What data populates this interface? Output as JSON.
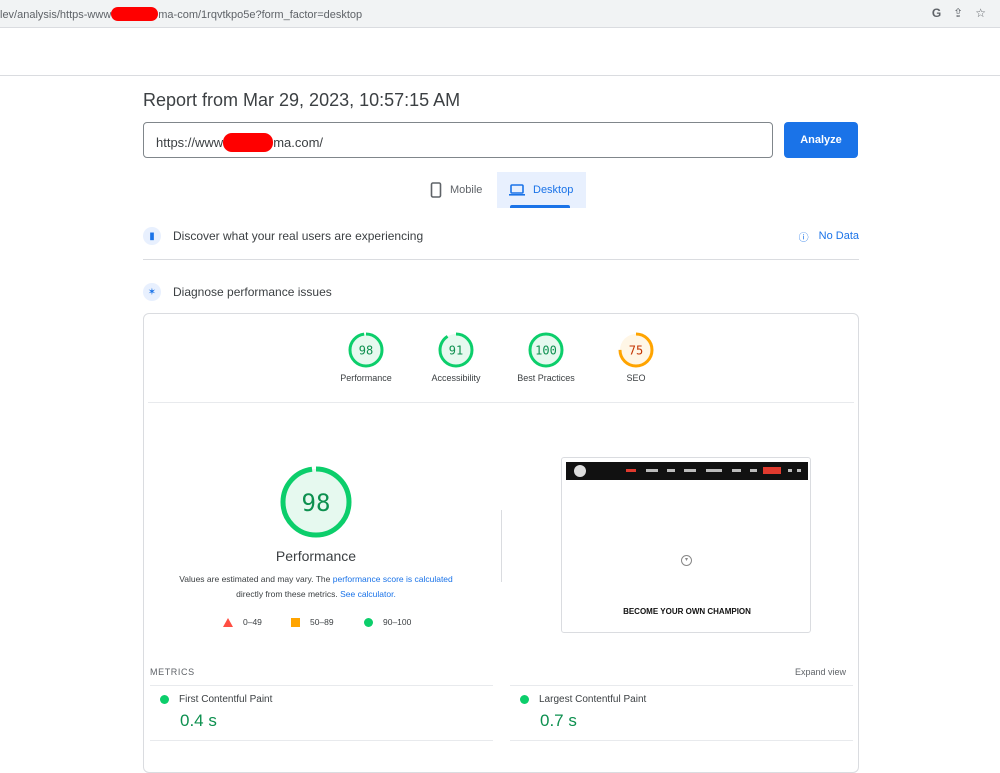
{
  "browser": {
    "url_prefix": "lev/analysis/https-www",
    "url_suffix": "ma-com/1rqvtkpo5e?form_factor=desktop",
    "icons": [
      "google-icon",
      "share-icon",
      "bookmark-star-icon"
    ]
  },
  "header": {
    "report_title": "Report from Mar 29, 2023, 10:57:15 AM"
  },
  "search": {
    "url_prefix": "https://www",
    "url_suffix": "ma.com/",
    "analyze_label": "Analyze"
  },
  "tabs": [
    {
      "label": "Mobile",
      "icon": "smartphone-icon",
      "active": false
    },
    {
      "label": "Desktop",
      "icon": "laptop-icon",
      "active": true
    }
  ],
  "field_data": {
    "label": "Discover what your real users are experiencing",
    "status": "No Data"
  },
  "lab_data": {
    "label": "Diagnose performance issues"
  },
  "scores": [
    {
      "label": "Performance",
      "value": "98",
      "color": "#0cce6b"
    },
    {
      "label": "Accessibility",
      "value": "91",
      "color": "#0cce6b"
    },
    {
      "label": "Best Practices",
      "value": "100",
      "color": "#0cce6b"
    },
    {
      "label": "SEO",
      "value": "75",
      "color": "#ffa400"
    }
  ],
  "performance": {
    "score": "98",
    "title": "Performance",
    "note_1": "Values are estimated and may vary. The",
    "note_link_1": "performance score is calculated",
    "note_2": "directly from these metrics.",
    "note_link_2": "See calculator."
  },
  "legend": [
    {
      "range": "0–49",
      "shape": "triangle",
      "color": "#ff4e42"
    },
    {
      "range": "50–89",
      "shape": "square",
      "color": "#ffa400"
    },
    {
      "range": "90–100",
      "shape": "circle",
      "color": "#0cce6b"
    }
  ],
  "screenshot": {
    "caption": "BECOME YOUR OWN CHAMPION"
  },
  "metrics": {
    "label": "METRICS",
    "expand": "Expand view",
    "items": [
      {
        "name": "First Contentful Paint",
        "value": "0.4 s"
      },
      {
        "name": "Largest Contentful Paint",
        "value": "0.7 s"
      }
    ]
  }
}
